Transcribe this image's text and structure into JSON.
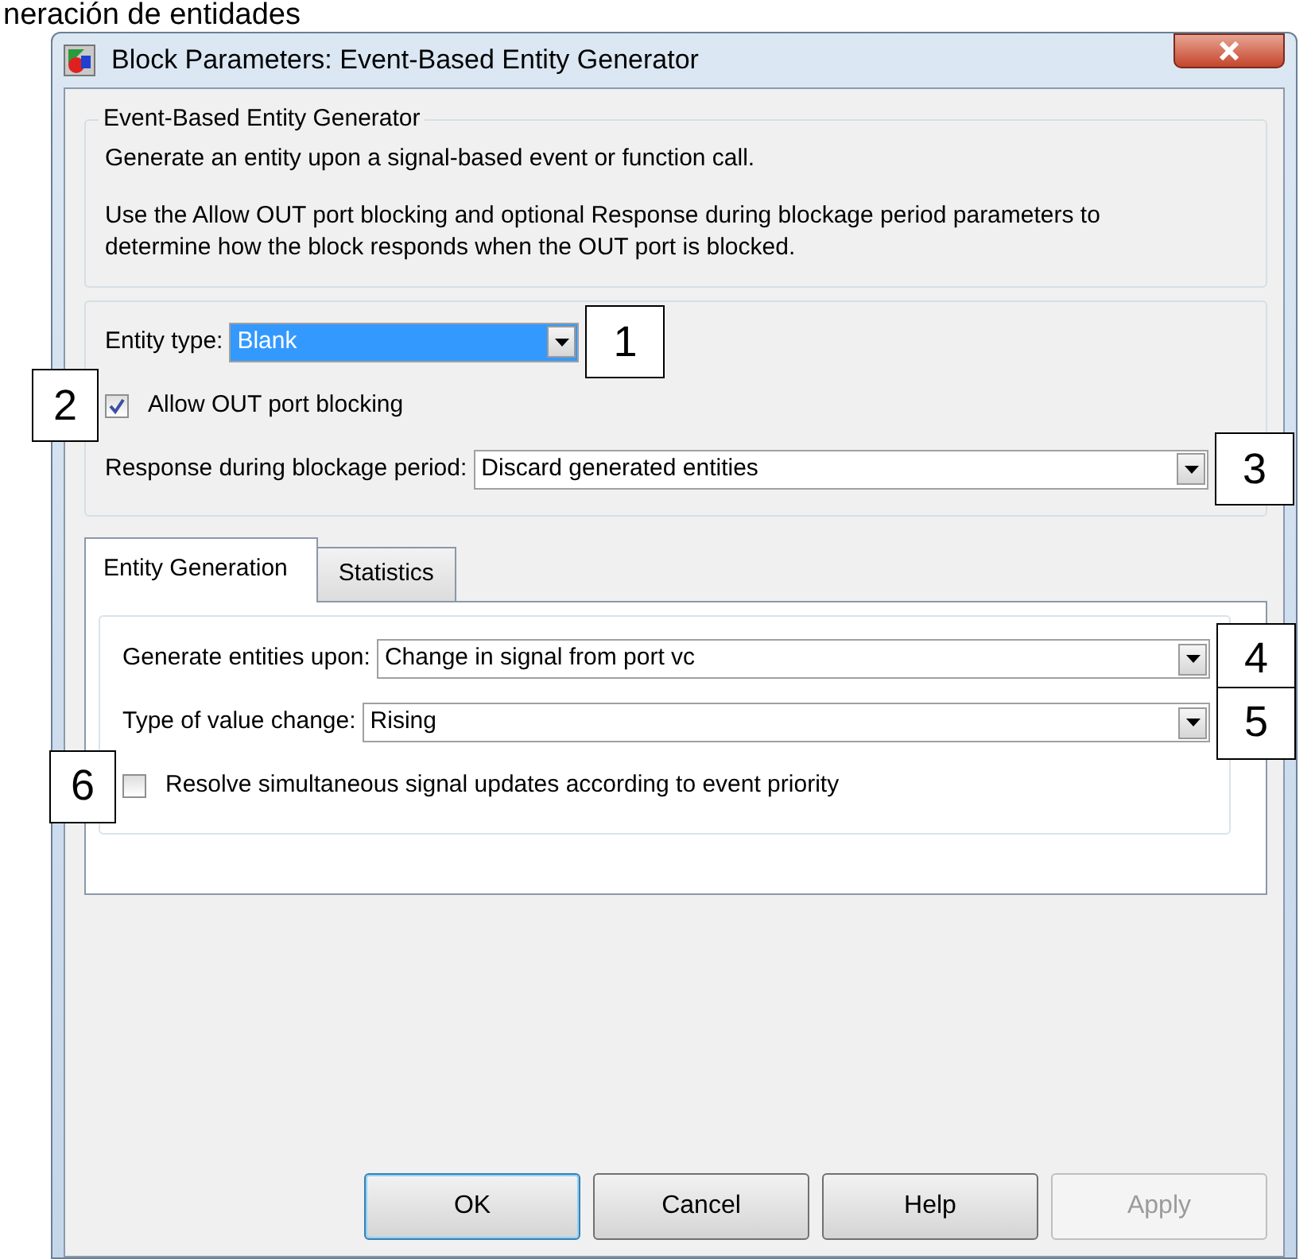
{
  "caption": "neración de entidades",
  "window": {
    "title": "Block Parameters: Event-Based Entity Generator"
  },
  "description_group": {
    "title": "Event-Based Entity Generator",
    "paragraphs": [
      "Generate an entity upon a signal-based event or function call.",
      "Use the Allow OUT port blocking and optional Response during blockage period parameters to determine how the block responds when the OUT port is blocked."
    ]
  },
  "main_params": [
    {
      "kind": "dropdown",
      "label": "Entity type:",
      "value": "Blank",
      "focused": true,
      "callout": "1"
    },
    {
      "kind": "checkbox",
      "label": "Allow OUT port blocking",
      "checked": true,
      "callout": "2"
    },
    {
      "kind": "dropdown",
      "label": "Response during blockage period:",
      "value": "Discard generated entities",
      "focused": false,
      "callout": "3"
    }
  ],
  "tabs": [
    {
      "label": "Entity Generation",
      "selected": true
    },
    {
      "label": "Statistics",
      "selected": false
    }
  ],
  "tab_params": [
    {
      "kind": "dropdown",
      "label": "Generate entities upon:",
      "value": "Change in signal from port vc",
      "focused": false,
      "callout": "4"
    },
    {
      "kind": "dropdown",
      "label": "Type of value change:",
      "value": "Rising",
      "focused": false,
      "callout": "5"
    },
    {
      "kind": "checkbox",
      "label": "Resolve simultaneous signal updates according to event priority",
      "checked": false,
      "callout": "6"
    }
  ],
  "buttons": [
    {
      "label": "OK",
      "default": true,
      "disabled": false
    },
    {
      "label": "Cancel",
      "default": false,
      "disabled": false
    },
    {
      "label": "Help",
      "default": false,
      "disabled": false
    },
    {
      "label": "Apply",
      "default": false,
      "disabled": true
    }
  ]
}
